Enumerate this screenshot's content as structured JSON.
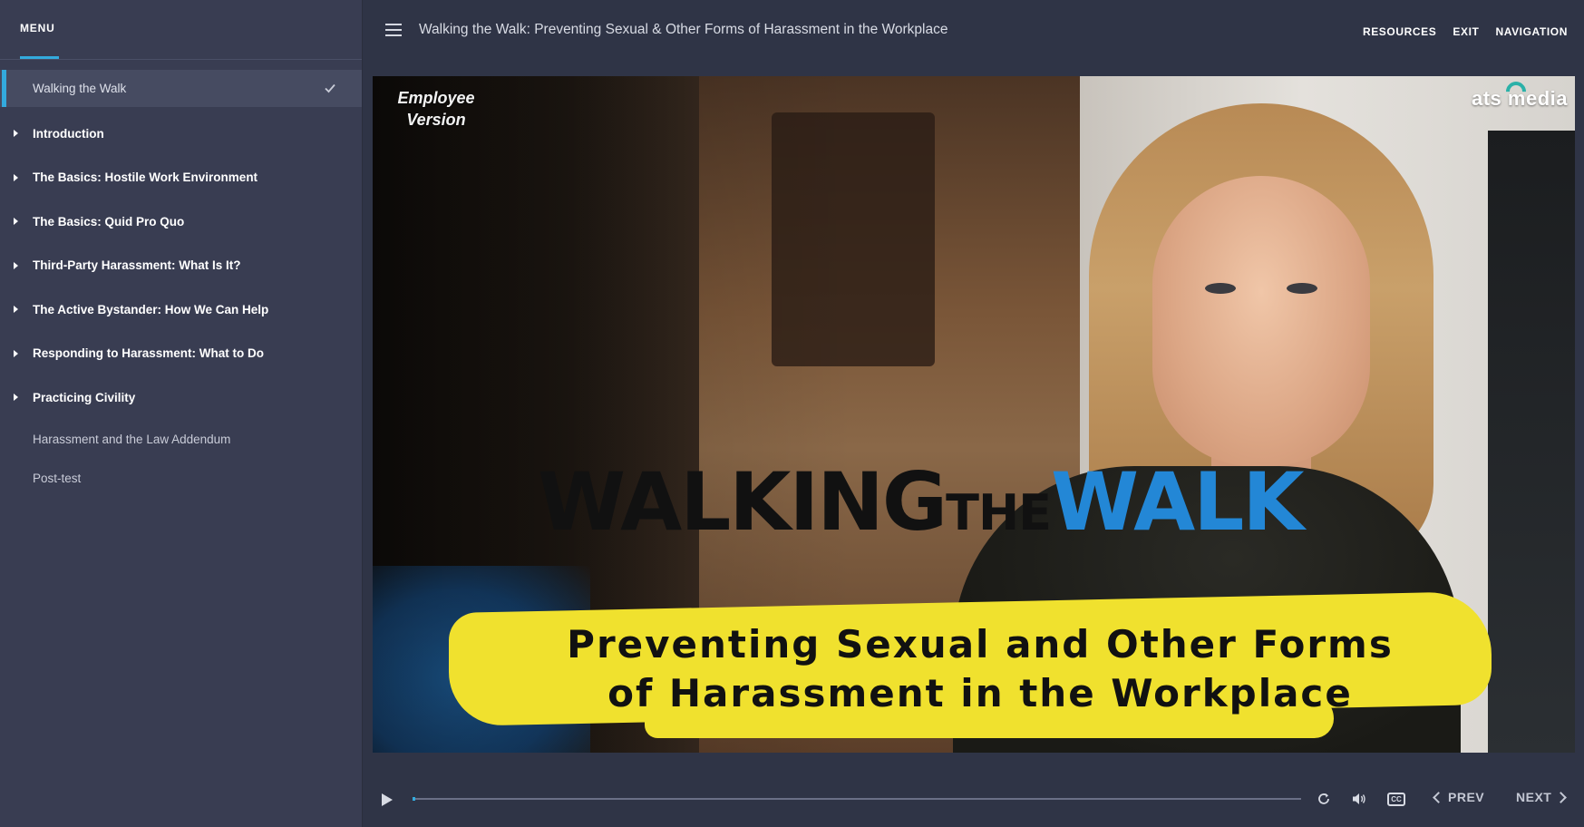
{
  "sidebar": {
    "menu_tab": "MENU",
    "items": [
      {
        "label": "Walking the Walk",
        "kind": "active",
        "completed": true
      },
      {
        "label": "Introduction",
        "kind": "section"
      },
      {
        "label": "The Basics: Hostile Work Environment",
        "kind": "section"
      },
      {
        "label": "The Basics: Quid Pro Quo",
        "kind": "section"
      },
      {
        "label": "Third-Party Harassment: What Is It?",
        "kind": "section"
      },
      {
        "label": "The Active Bystander: How We Can Help",
        "kind": "section"
      },
      {
        "label": "Responding to Harassment: What to Do",
        "kind": "section"
      },
      {
        "label": "Practicing Civility",
        "kind": "section"
      },
      {
        "label": "Harassment and the Law Addendum",
        "kind": "plain"
      },
      {
        "label": "Post-test",
        "kind": "plain"
      }
    ]
  },
  "header": {
    "title": "Walking the Walk: Preventing Sexual & Other Forms of Harassment in the Workplace",
    "nav": {
      "resources": "RESOURCES",
      "exit": "EXIT",
      "navigation": "NAVIGATION"
    }
  },
  "video": {
    "version_label_line1": "Employee",
    "version_label_line2": "Version",
    "logo_text": "ats media",
    "headline_part1": "WALKING",
    "headline_part2": "THE",
    "headline_part3": "WALK",
    "subtitle_line1": "Preventing Sexual and Other Forms",
    "subtitle_line2": "of Harassment in the Workplace"
  },
  "controls": {
    "progress_percent": 0.3,
    "prev_label": "PREV",
    "next_label": "NEXT"
  },
  "colors": {
    "accent": "#33aadd",
    "headline_blue": "#2387d6",
    "highlight_yellow": "#f0e12e"
  },
  "icons": {
    "menu": "hamburger-icon",
    "play": "play-icon",
    "replay": "replay-icon",
    "volume": "volume-icon",
    "captions": "closed-captions-icon",
    "completed": "checkmark-icon"
  }
}
